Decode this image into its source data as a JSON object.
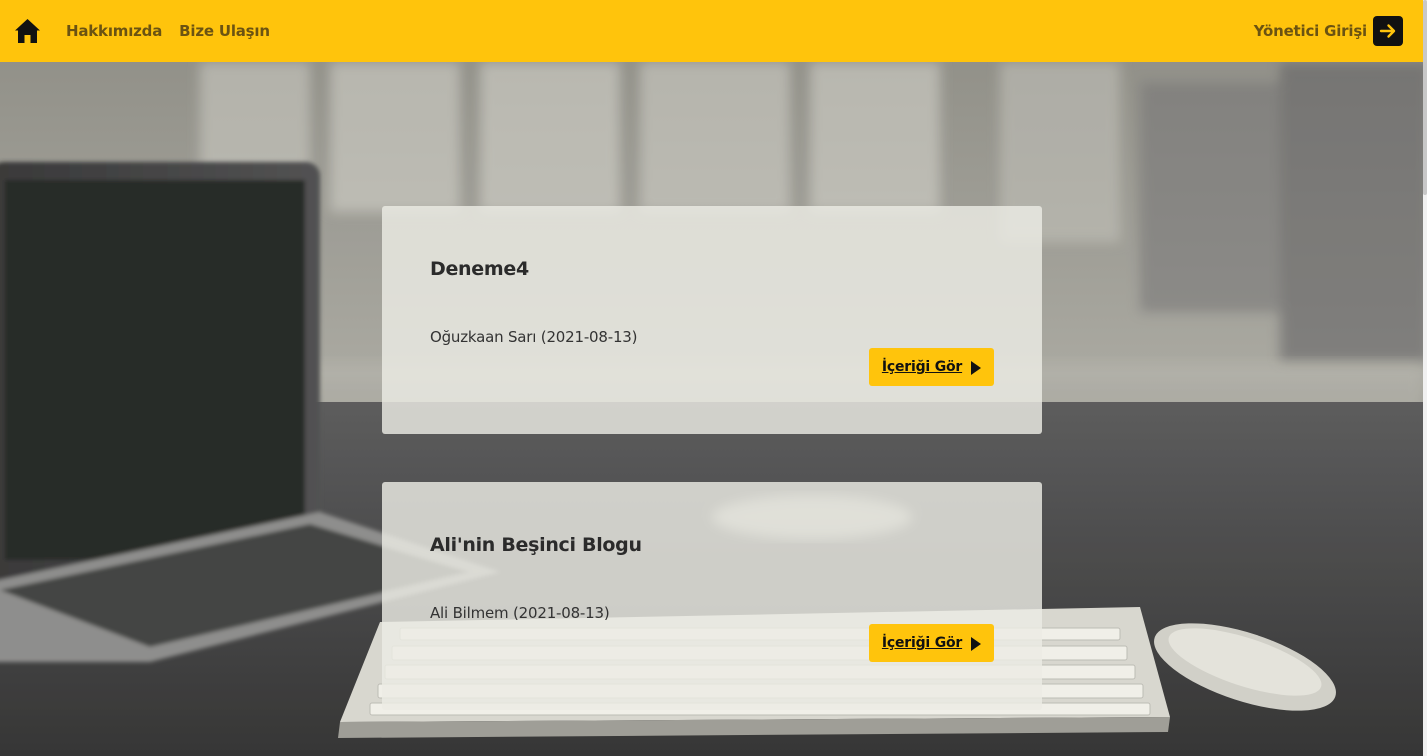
{
  "navbar": {
    "home_icon": "home-icon",
    "about_label": "Hakkımızda",
    "contact_label": "Bize Ulaşın",
    "admin_label": "Yönetici Girişi",
    "admin_icon": "arrow-right-icon",
    "accent_color": "#ffc40c"
  },
  "posts": [
    {
      "title": "Deneme4",
      "meta": "Oğuzkaan Sarı (2021-08-13)",
      "button_label": "İçeriği Gör"
    },
    {
      "title": "Ali'nin Beşinci Blogu",
      "meta": "Ali Bilmem (2021-08-13)",
      "button_label": "İçeriği Gör"
    }
  ]
}
